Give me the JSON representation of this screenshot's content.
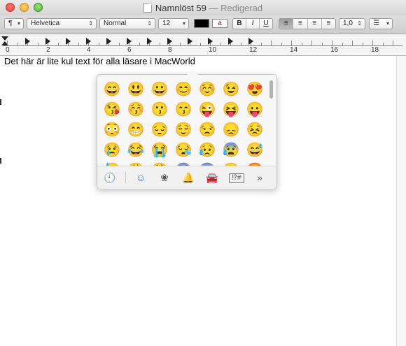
{
  "window": {
    "title": "Namnlöst 59",
    "separator": "—",
    "status": "Redigerad"
  },
  "toolbar": {
    "paragraph_style": "¶",
    "font_family": "Helvetica",
    "font_style": "Normal",
    "font_size": "12",
    "text_color": "#000000",
    "highlight_label": "a",
    "bold": "B",
    "italic": "I",
    "underline": "U",
    "line_spacing": "1,0",
    "list_icon": "list-bullets-icon"
  },
  "ruler": {
    "numbers": [
      "0",
      "2",
      "4",
      "6",
      "8",
      "10",
      "12",
      "14",
      "16",
      "18"
    ]
  },
  "document": {
    "text": "Det här är lite kul text för alla läsare i MacWorld"
  },
  "emoji_picker": {
    "rows": [
      [
        "😄",
        "😃",
        "😀",
        "😊",
        "☺️",
        "😉",
        "😍"
      ],
      [
        "😘",
        "😚",
        "😗",
        "😙",
        "😜",
        "😝",
        "😛"
      ],
      [
        "😳",
        "😁",
        "😔",
        "😌",
        "😒",
        "😞",
        "😣"
      ],
      [
        "😢",
        "😂",
        "😭",
        "😪",
        "😥",
        "😰",
        "😅"
      ],
      [
        "😓",
        "😩",
        "😫",
        "😨",
        "😱",
        "😠",
        "😡"
      ]
    ],
    "tabs": [
      {
        "name": "recent-icon",
        "glyph": "🕘",
        "active": false
      },
      {
        "name": "smileys-icon",
        "glyph": "☺",
        "active": true
      },
      {
        "name": "flower-icon",
        "glyph": "❀",
        "active": false
      },
      {
        "name": "bell-icon",
        "glyph": "🔔",
        "active": false
      },
      {
        "name": "car-icon",
        "glyph": "🚘",
        "active": false
      },
      {
        "name": "symbols-icon",
        "glyph": "⁉#",
        "active": false
      },
      {
        "name": "more-icon",
        "glyph": "»",
        "active": false
      }
    ]
  }
}
